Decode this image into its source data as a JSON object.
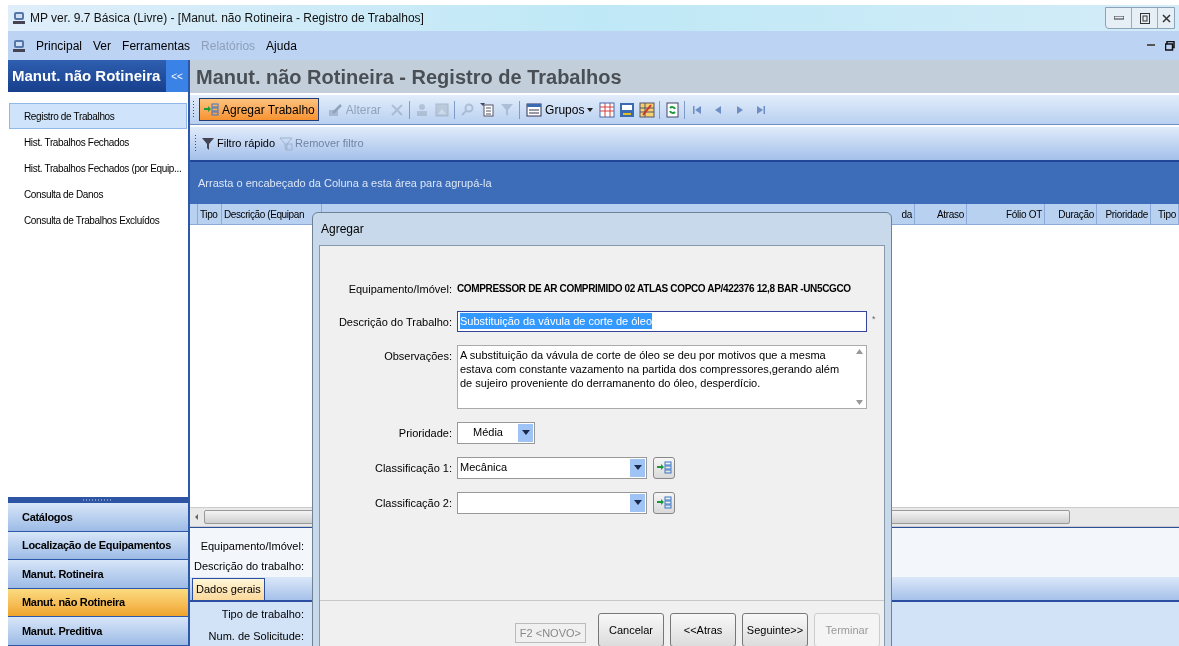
{
  "window": {
    "title": "MP ver. 9.7 Básica (Livre) - [Manut. não Rotineira - Registro de Trabalhos]"
  },
  "menu": [
    {
      "label": "Principal",
      "disabled": false
    },
    {
      "label": "Ver",
      "disabled": false
    },
    {
      "label": "Ferramentas",
      "disabled": false
    },
    {
      "label": "Relatórios",
      "disabled": true
    },
    {
      "label": "Ajuda",
      "disabled": false
    }
  ],
  "sidebar": {
    "title": "Manut. não Rotineira",
    "collapse": "<<",
    "items": [
      {
        "label": "Registro de Trabalhos",
        "selected": true
      },
      {
        "label": "Hist. Trabalhos Fechados",
        "selected": false
      },
      {
        "label": "Hist. Trabalhos Fechados (por Equip...",
        "selected": false
      },
      {
        "label": "Consulta de Danos",
        "selected": false
      },
      {
        "label": "Consulta de Trabalhos Excluídos",
        "selected": false
      }
    ],
    "nav": [
      {
        "label": "Catálogos",
        "selected": false
      },
      {
        "label": "Localização de Equipamentos",
        "selected": false
      },
      {
        "label": "Manut. Rotineira",
        "selected": false
      },
      {
        "label": "Manut. não Rotineira",
        "selected": true
      },
      {
        "label": "Manut. Preditiva",
        "selected": false
      }
    ]
  },
  "page_title": "Manut. não Rotineira - Registro de Trabalhos",
  "toolbar": [
    {
      "kind": "button",
      "label": "Agregar Trabalho",
      "highlighted": true,
      "disabled": false
    },
    {
      "kind": "button",
      "label": "Alterar",
      "highlighted": false,
      "disabled": true
    },
    {
      "kind": "icon",
      "disabled": true
    },
    {
      "kind": "separator"
    },
    {
      "kind": "icon",
      "disabled": true
    },
    {
      "kind": "icon",
      "disabled": true
    },
    {
      "kind": "separator"
    },
    {
      "kind": "icon",
      "disabled": true
    },
    {
      "kind": "icon",
      "disabled": false
    },
    {
      "kind": "icon",
      "disabled": true
    },
    {
      "kind": "separator"
    },
    {
      "kind": "dropdown",
      "label": "Grupos"
    },
    {
      "kind": "icon",
      "disabled": false
    },
    {
      "kind": "icon",
      "disabled": false
    },
    {
      "kind": "icon",
      "disabled": false
    },
    {
      "kind": "separator"
    },
    {
      "kind": "icon",
      "disabled": false
    },
    {
      "kind": "separator"
    },
    {
      "kind": "nav"
    },
    {
      "kind": "nav"
    },
    {
      "kind": "nav"
    },
    {
      "kind": "nav"
    }
  ],
  "filter_bar": [
    {
      "label": "Filtro rápido",
      "disabled": false
    },
    {
      "label": "Remover filtro",
      "disabled": true
    }
  ],
  "group_hint": "Arrasta o encabeçado da Coluna a esta área para agrupá-la",
  "grid": {
    "columns_left": [
      "Tipo",
      "Descrição (Equipan"
    ],
    "columns_right": [
      "da",
      "Atraso",
      "Fólio OT",
      "Duração",
      "Prioridade",
      "Tipo"
    ]
  },
  "detail": {
    "labels": [
      "Equipamento/Imóvel:",
      "Descrição do trabalho:"
    ],
    "tabs": [
      {
        "label": "Dados gerais",
        "selected": true
      }
    ],
    "fields": [
      "Tipo de trabalho:",
      "Num. de Solicitude:"
    ]
  },
  "dialog": {
    "title": "Agregar",
    "equipment": {
      "label": "Equipamento/Imóvel:",
      "value": "COMPRESSOR DE AR COMPRIMIDO 02 ATLAS COPCO AP/422376 12,8 BAR -UN5CGCO"
    },
    "description": {
      "label": "Descrição do Trabalho:",
      "value": "Substituição da vávula de corte de óleo",
      "text_selected": true,
      "required_mark": "*"
    },
    "observations": {
      "label": "Observações:",
      "value": "A substituição da vávula de corte de óleo se deu por motivos que a mesma estava com constante vazamento na partida dos compressores,gerando além de sujeiro proveniente do derramanento do óleo, desperdício."
    },
    "priority": {
      "label": "Prioridade:",
      "value": "Média"
    },
    "classifications": [
      {
        "label": "Classificação 1:",
        "value": "Mecânica"
      },
      {
        "label": "Classificação 2:"
      }
    ],
    "new_hint": "F2 <NOVO>",
    "buttons": [
      {
        "label": "Cancelar",
        "disabled": false
      },
      {
        "label": "<<Atras",
        "disabled": false
      },
      {
        "label": "Seguinte>>",
        "disabled": false
      },
      {
        "label": "Terminar",
        "disabled": true
      }
    ]
  }
}
